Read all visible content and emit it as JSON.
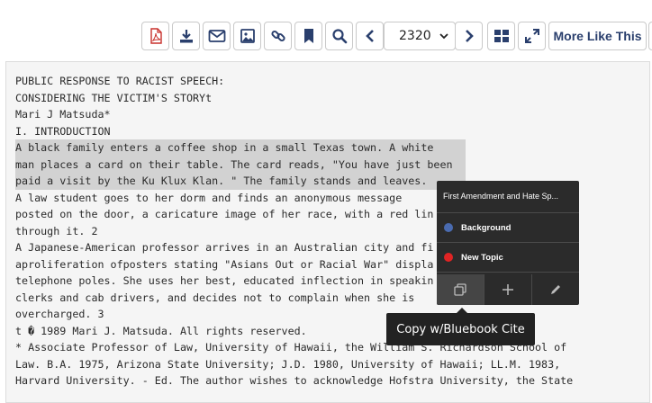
{
  "toolbar": {
    "buttons": [
      "pdf-icon",
      "download-icon",
      "email-icon",
      "image-icon",
      "link-icon",
      "bookmark-icon",
      "search-icon",
      "chevron-left-icon",
      "chevron-right-icon",
      "grid-icon",
      "expand-icon"
    ],
    "page_number": "2320",
    "more_like_this": "More Like This",
    "colors": {
      "pdf": "#c8302c",
      "icon": "#2a3f6d",
      "border": "#c9c9c9"
    }
  },
  "document": {
    "lines": [
      "PUBLIC RESPONSE TO RACIST SPEECH:",
      "CONSIDERING THE VICTIM'S STORYt",
      "Mari J Matsuda*",
      "I. INTRODUCTION",
      "A black family enters a coffee shop in a small Texas town. A white",
      "man places a card on their table. The card reads, \"You have just been",
      "paid a visit by the Ku Klux Klan. \" The family stands and leaves.",
      "A law student goes to her dorm and finds an anonymous message",
      "posted on the door, a caricature image of her race, with a red lin",
      "through it. 2",
      "A Japanese-American professor arrives in an Australian city and fi",
      "aproliferation ofposters stating \"Asians Out or Racial War\" displa",
      "telephone poles. She uses her best, educated inflection in speakin",
      "clerks and cab drivers, and decides not to complain when she is",
      "overcharged. 3",
      "t � 1989 Mari J. Matsuda. All rights reserved.",
      "* Associate Professor of Law, University of Hawaii, the William S. Richardson School of",
      "Law. B.A. 1975, Arizona State University; J.D. 1980, University of Hawaii; LL.M. 1983,",
      "Harvard University. - Ed. The author wishes to acknowledge Hofstra University, the State"
    ],
    "highlight_lines": [
      4,
      5,
      6
    ]
  },
  "popup": {
    "title": "First Amendment and Hate Sp...",
    "items": [
      {
        "label": "Background",
        "color": "#4a6bb0"
      },
      {
        "label": "New Topic",
        "color": "#e02424"
      }
    ],
    "actions": [
      "copy-icon",
      "plus-icon",
      "pencil-icon"
    ]
  },
  "tooltip": {
    "text": "Copy w/Bluebook Cite"
  }
}
